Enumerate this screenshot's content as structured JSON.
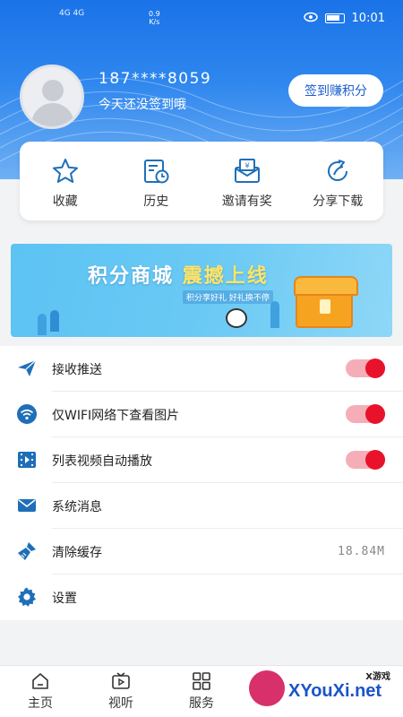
{
  "status_bar": {
    "signal": "4G 4G",
    "speed_value": "0.9",
    "speed_unit": "K/s",
    "time": "10:01"
  },
  "profile": {
    "phone": "187****8059",
    "sign_status": "今天还没签到哦",
    "sign_button": "签到赚积分"
  },
  "quick_actions": [
    {
      "label": "收藏",
      "icon": "star-icon"
    },
    {
      "label": "历史",
      "icon": "history-icon"
    },
    {
      "label": "邀请有奖",
      "icon": "invite-gift-icon"
    },
    {
      "label": "分享下载",
      "icon": "share-icon"
    }
  ],
  "banner": {
    "title_part1": "积分商城",
    "title_part2": "震撼上线",
    "subtitle": "积分享好礼  好礼换不停"
  },
  "settings": [
    {
      "label": "接收推送",
      "icon": "send-icon",
      "toggle": true
    },
    {
      "label": "仅WIFI网络下查看图片",
      "icon": "wifi-icon",
      "toggle": true
    },
    {
      "label": "列表视频自动播放",
      "icon": "video-icon",
      "toggle": true
    },
    {
      "label": "系统消息",
      "icon": "mail-icon",
      "toggle": false
    },
    {
      "label": "清除缓存",
      "icon": "broom-icon",
      "value": "18.84M"
    },
    {
      "label": "设置",
      "icon": "gear-icon",
      "toggle": false
    }
  ],
  "bottom_nav": [
    {
      "label": "主页",
      "icon": "home-icon"
    },
    {
      "label": "视听",
      "icon": "tv-icon"
    },
    {
      "label": "服务",
      "icon": "grid-icon"
    }
  ],
  "watermark": {
    "text": "XYouXi.net",
    "small": "X游戏"
  },
  "colors": {
    "accent_blue": "#1a73e8",
    "icon_blue": "#1f6fb8",
    "toggle_red": "#e8132b",
    "toggle_track": "#f5aeb7"
  }
}
